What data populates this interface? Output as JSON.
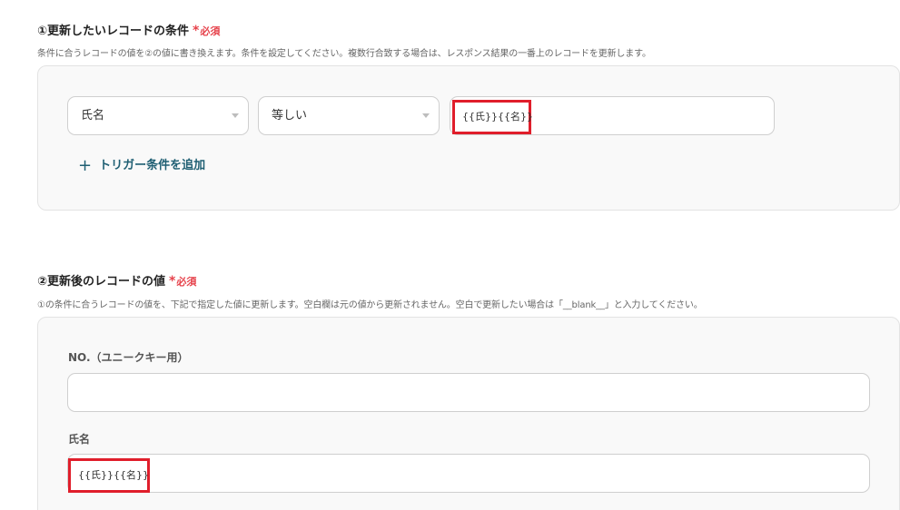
{
  "condition_section": {
    "title": "①更新したいレコードの条件",
    "required_mark": "*",
    "required_label": "必須",
    "description": "条件に合うレコードの値を②の値に書き換えます。条件を設定してください。複数行合致する場合は、レスポンス結果の一番上のレコードを更新します。",
    "field_select": "氏名",
    "operator_select": "等しい",
    "value": "{{氏}}{{名}}",
    "add_trigger_label": "トリガー条件を追加",
    "add_icon": "plus-icon"
  },
  "update_section": {
    "title": "②更新後のレコードの値",
    "required_mark": "*",
    "required_label": "必須",
    "description": "①の条件に合うレコードの値を、下記で指定した値に更新します。空白欄は元の値から更新されません。空白で更新したい場合は「__blank__」と入力してください。",
    "fields": [
      {
        "label": "NO.（ユニークキー用）",
        "value": ""
      },
      {
        "label": "氏名",
        "value": "{{氏}}{{名}}"
      }
    ]
  },
  "colors": {
    "required": "#e6424b",
    "highlight_border": "#e01e2b",
    "link": "#1f5f73",
    "panel_bg": "#f9f9f9"
  }
}
